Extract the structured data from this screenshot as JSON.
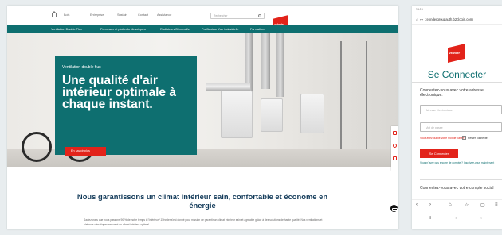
{
  "desktop": {
    "topnav": [
      "Bois",
      "Entreprise",
      "Sustain",
      "Contact",
      "Assistance"
    ],
    "search_placeholder": "Rechercher",
    "logo_text": "zehnder",
    "mainnav": [
      "Ventilation Double Flux",
      "Panneaux et plafonds climatiques",
      "Radiateurs Décoratifs",
      "Purificateur d'air industrielle",
      "Formations"
    ],
    "hero": {
      "kicker": "Ventilation double flux",
      "title": "Une qualité d'air intérieur optimale à chaque instant.",
      "cta": "En savoir plus"
    },
    "section_title": "Nous garantissons un climat intérieur sain, confortable et économe en énergie",
    "section_body": "Saviez-vous que nous passons 90 % de notre temps à l'intérieur? Zehnder s'est donné pour mission de garantir un climat intérieur sain et agréable grâce à des solutions de haute qualité. Nos ventilations et plafonds climatiques assurent un climat intérieur optimal"
  },
  "mobile": {
    "status_time": "16:16",
    "url": "zehndergroupauth.b2clogin.com",
    "title": "Se Connecter",
    "lead": "Connectez-vous avec votre adresse électronique.",
    "email_placeholder": "Adresse électronique",
    "password_placeholder": "Mot de passe",
    "forgot": "Vous avez oublié votre mot de passe?",
    "remember": "Rester connecté",
    "button": "Se Connecter",
    "no_account": "Vous n'avez pas encore de compte ? Inscrivez-vous maintenant",
    "social": "Connectez-vous avec votre compte social"
  },
  "colors": {
    "teal": "#0e6f70",
    "red": "#e2231a",
    "navy": "#133b5a"
  }
}
